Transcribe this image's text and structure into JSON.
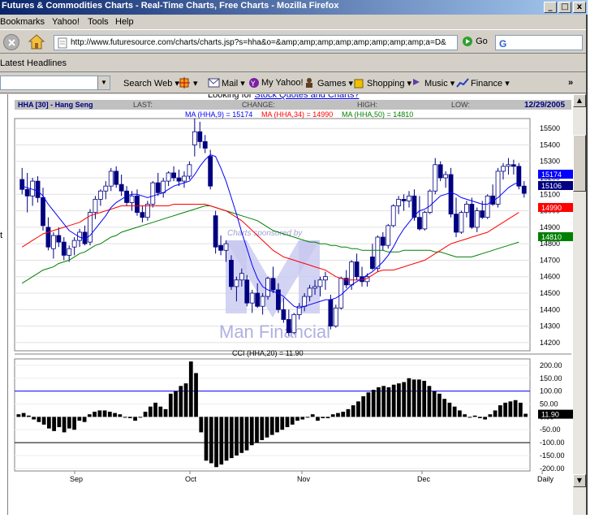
{
  "window": {
    "title": "Futures & Commodities Charts - Real-Time Charts, Free Charts - Mozilla Firefox",
    "minimize": "_",
    "maximize": "□",
    "close": "x"
  },
  "menu": [
    "Bookmarks",
    "Yahoo!",
    "Tools",
    "Help"
  ],
  "navigation": {
    "url": "http://www.futuresource.com/charts/charts.jsp?s=hha&o=&amp;amp;amp;amp;amp;amp;amp;amp;a=D&",
    "go_label": "Go",
    "search_value": ""
  },
  "bookmarks_bar": {
    "item": "Latest Headlines"
  },
  "yahoo_toolbar": {
    "items": [
      "Search Web",
      "Mail",
      "My Yahoo!",
      "Games",
      "Shopping",
      "Music",
      "Finance"
    ],
    "more": "»"
  },
  "page": {
    "lookup_prefix": "Looking for ",
    "lookup_link": "Stock Quotes and Charts?",
    "sidebar_char": "t"
  },
  "colors": {
    "candle_up": "#ffffff",
    "candle_down": "#000080",
    "ma9": "#0000ff",
    "ma34": "#ff0000",
    "ma50": "#008000",
    "cci_bar": "#000000",
    "cci_upper_line": "#0000ff",
    "watermark": "#c8c8f0",
    "header_bg": "#c0c0c0"
  },
  "chart_data": [
    {
      "type": "candlestick",
      "title": "HHA [30] - Hang Seng",
      "header_fields": [
        "LAST:",
        "CHANGE:",
        "HIGH:",
        "LOW:"
      ],
      "date": "12/29/2005",
      "indicators": [
        {
          "name": "MA (HHA,9)",
          "value": "15174",
          "label": "MA (HHA,9) = 15174",
          "color": "#0000ff"
        },
        {
          "name": "MA (HHA,34)",
          "value": "14990",
          "label": "MA (HHA,34) = 14990",
          "color": "#ff0000"
        },
        {
          "name": "MA (HHA,50)",
          "value": "14810",
          "label": "MA (HHA,50) = 14810",
          "color": "#008000"
        }
      ],
      "price_badges": [
        {
          "value": "15174",
          "bg": "#0000ff",
          "fg": "#ffffff"
        },
        {
          "value": "15106",
          "bg": "#000080",
          "fg": "#ffffff"
        },
        {
          "value": "14990",
          "bg": "#ff0000",
          "fg": "#ffffff"
        },
        {
          "value": "14810",
          "bg": "#008000",
          "fg": "#ffffff"
        }
      ],
      "watermark_text": [
        "Charts sponsored by",
        "Man Financial"
      ],
      "x_labels": [
        "Sep",
        "Oct",
        "Nov",
        "Dec",
        "Daily"
      ],
      "y_ticks": [
        15500,
        15400,
        15300,
        15200,
        15100,
        15000,
        14900,
        14800,
        14700,
        14600,
        14500,
        14400,
        14300,
        14200
      ],
      "ylim": [
        14150,
        15560
      ],
      "ohlc": [
        [
          15190,
          15260,
          15100,
          15130
        ],
        [
          15130,
          15230,
          14990,
          15090
        ],
        [
          15090,
          15200,
          15030,
          15180
        ],
        [
          15180,
          15210,
          15050,
          15080
        ],
        [
          15080,
          15140,
          14880,
          14910
        ],
        [
          14900,
          14960,
          14760,
          14780
        ],
        [
          14770,
          14870,
          14710,
          14850
        ],
        [
          14850,
          14900,
          14780,
          14810
        ],
        [
          14810,
          14840,
          14700,
          14730
        ],
        [
          14730,
          14790,
          14690,
          14770
        ],
        [
          14780,
          14840,
          14730,
          14820
        ],
        [
          14820,
          14890,
          14780,
          14870
        ],
        [
          14870,
          14910,
          14790,
          14800
        ],
        [
          14810,
          15010,
          14790,
          14990
        ],
        [
          14990,
          15090,
          14950,
          15070
        ],
        [
          15070,
          15130,
          15030,
          15120
        ],
        [
          15120,
          15180,
          15070,
          15150
        ],
        [
          15150,
          15260,
          15120,
          15240
        ],
        [
          15240,
          15270,
          15140,
          15160
        ],
        [
          15160,
          15220,
          15090,
          15120
        ],
        [
          15120,
          15150,
          15030,
          15050
        ],
        [
          15050,
          15120,
          15000,
          15090
        ],
        [
          15090,
          15130,
          14970,
          14990
        ],
        [
          14990,
          15030,
          14930,
          14960
        ],
        [
          14960,
          15060,
          14940,
          15040
        ],
        [
          15040,
          15180,
          15020,
          15170
        ],
        [
          15170,
          15230,
          15090,
          15110
        ],
        [
          15110,
          15200,
          15080,
          15180
        ],
        [
          15180,
          15240,
          15150,
          15230
        ],
        [
          15230,
          15270,
          15180,
          15200
        ],
        [
          15200,
          15250,
          15150,
          15180
        ],
        [
          15180,
          15240,
          15140,
          15210
        ],
        [
          15210,
          15300,
          15190,
          15280
        ],
        [
          15400,
          15560,
          15330,
          15480
        ],
        [
          15480,
          15540,
          15380,
          15420
        ],
        [
          15420,
          15460,
          15350,
          15380
        ],
        [
          15330,
          15370,
          15130,
          15150
        ],
        [
          14970,
          15000,
          14740,
          14780
        ],
        [
          14790,
          14850,
          14730,
          14760
        ],
        [
          14760,
          14820,
          14690,
          14800
        ],
        [
          14700,
          14730,
          14520,
          14540
        ],
        [
          14540,
          14600,
          14450,
          14580
        ],
        [
          14580,
          14650,
          14540,
          14620
        ],
        [
          14580,
          14610,
          14420,
          14440
        ],
        [
          14440,
          14520,
          14380,
          14500
        ],
        [
          14500,
          14560,
          14410,
          14420
        ],
        [
          14420,
          14500,
          14370,
          14480
        ],
        [
          14480,
          14600,
          14460,
          14590
        ],
        [
          14590,
          14660,
          14500,
          14520
        ],
        [
          14520,
          14560,
          14380,
          14400
        ],
        [
          14400,
          14470,
          14320,
          14340
        ],
        [
          14340,
          14400,
          14240,
          14260
        ],
        [
          14260,
          14380,
          14250,
          14370
        ],
        [
          14370,
          14440,
          14340,
          14420
        ],
        [
          14420,
          14500,
          14390,
          14480
        ],
        [
          14480,
          14550,
          14450,
          14530
        ],
        [
          14530,
          14580,
          14490,
          14540
        ],
        [
          14540,
          14600,
          14480,
          14580
        ],
        [
          14580,
          14630,
          14520,
          14600
        ],
        [
          14460,
          14490,
          14280,
          14300
        ],
        [
          14300,
          14430,
          14290,
          14410
        ],
        [
          14410,
          14600,
          14400,
          14590
        ],
        [
          14590,
          14640,
          14530,
          14550
        ],
        [
          14550,
          14700,
          14520,
          14690
        ],
        [
          14690,
          14740,
          14580,
          14600
        ],
        [
          14600,
          14660,
          14540,
          14570
        ],
        [
          14570,
          14620,
          14540,
          14600
        ],
        [
          14720,
          14800,
          14640,
          14650
        ],
        [
          14650,
          14850,
          14630,
          14840
        ],
        [
          14840,
          14870,
          14760,
          14790
        ],
        [
          14790,
          14920,
          14770,
          14910
        ],
        [
          14910,
          15040,
          14900,
          15030
        ],
        [
          15030,
          15090,
          14980,
          15070
        ],
        [
          15070,
          15100,
          15000,
          15060
        ],
        [
          15060,
          15120,
          15020,
          15090
        ],
        [
          15090,
          15130,
          14940,
          14960
        ],
        [
          14960,
          15090,
          14880,
          14890
        ],
        [
          14890,
          15000,
          14880,
          14990
        ],
        [
          14990,
          15130,
          14980,
          15120
        ],
        [
          15120,
          15320,
          15100,
          15280
        ],
        [
          15280,
          15300,
          15180,
          15200
        ],
        [
          15200,
          15240,
          15140,
          15220
        ],
        [
          15220,
          15260,
          14960,
          14980
        ],
        [
          14980,
          15080,
          14840,
          14870
        ],
        [
          14870,
          15000,
          14860,
          14990
        ],
        [
          14990,
          15060,
          14960,
          15040
        ],
        [
          15040,
          15080,
          14890,
          14900
        ],
        [
          14900,
          15020,
          14870,
          15000
        ],
        [
          15000,
          15060,
          14950,
          14960
        ],
        [
          14960,
          15100,
          14950,
          15090
        ],
        [
          15090,
          15160,
          15030,
          15040
        ],
        [
          15040,
          15260,
          15020,
          15240
        ],
        [
          15240,
          15290,
          15190,
          15270
        ],
        [
          15270,
          15320,
          15220,
          15280
        ],
        [
          15280,
          15310,
          15220,
          15270
        ],
        [
          15270,
          15290,
          15130,
          15150
        ],
        [
          15150,
          15180,
          15080,
          15106
        ]
      ],
      "ma9": [
        15150,
        15140,
        15130,
        15120,
        15090,
        15040,
        15000,
        14960,
        14920,
        14880,
        14860,
        14840,
        14830,
        14850,
        14890,
        14930,
        14970,
        15020,
        15050,
        15070,
        15090,
        15100,
        15100,
        15090,
        15080,
        15090,
        15100,
        15110,
        15130,
        15150,
        15160,
        15170,
        15180,
        15220,
        15270,
        15310,
        15340,
        15330,
        15260,
        15180,
        15080,
        14980,
        14870,
        14770,
        14670,
        14590,
        14540,
        14520,
        14510,
        14500,
        14480,
        14450,
        14420,
        14410,
        14420,
        14430,
        14440,
        14450,
        14460,
        14460,
        14470,
        14490,
        14520,
        14550,
        14570,
        14590,
        14610,
        14630,
        14660,
        14690,
        14730,
        14780,
        14840,
        14890,
        14930,
        14970,
        15000,
        15010,
        15030,
        15060,
        15090,
        15100,
        15110,
        15100,
        15080,
        15070,
        15060,
        15050,
        15040,
        15040,
        15060,
        15080,
        15110,
        15140,
        15160,
        15174
      ],
      "ma34": [
        14780,
        14800,
        14820,
        14840,
        14860,
        14870,
        14880,
        14890,
        14900,
        14910,
        14920,
        14930,
        14950,
        14970,
        14980,
        14990,
        15000,
        15010,
        15020,
        15030,
        15030,
        15030,
        15030,
        15030,
        15030,
        15030,
        15030,
        15030,
        15030,
        15040,
        15040,
        15040,
        15040,
        15040,
        15040,
        15040,
        15030,
        15020,
        15010,
        15000,
        14980,
        14960,
        14940,
        14910,
        14880,
        14850,
        14820,
        14790,
        14760,
        14740,
        14720,
        14710,
        14700,
        14690,
        14680,
        14670,
        14660,
        14650,
        14640,
        14620,
        14600,
        14590,
        14580,
        14580,
        14580,
        14580,
        14590,
        14610,
        14630,
        14640,
        14640,
        14640,
        14650,
        14660,
        14670,
        14680,
        14690,
        14700,
        14720,
        14740,
        14760,
        14780,
        14800,
        14810,
        14820,
        14830,
        14840,
        14850,
        14860,
        14870,
        14890,
        14910,
        14930,
        14950,
        14970,
        14990
      ],
      "ma50": [
        14560,
        14580,
        14600,
        14620,
        14640,
        14650,
        14660,
        14680,
        14690,
        14700,
        14720,
        14740,
        14750,
        14770,
        14790,
        14800,
        14820,
        14840,
        14850,
        14870,
        14880,
        14890,
        14900,
        14910,
        14920,
        14930,
        14940,
        14950,
        14960,
        14970,
        14980,
        14990,
        15000,
        15010,
        15020,
        15030,
        15030,
        15020,
        15010,
        15000,
        14990,
        14980,
        14970,
        14960,
        14950,
        14940,
        14920,
        14900,
        14880,
        14870,
        14860,
        14850,
        14840,
        14830,
        14820,
        14810,
        14810,
        14800,
        14800,
        14790,
        14790,
        14780,
        14780,
        14770,
        14770,
        14760,
        14760,
        14760,
        14760,
        14760,
        14750,
        14750,
        14750,
        14760,
        14760,
        14760,
        14760,
        14760,
        14760,
        14750,
        14750,
        14740,
        14730,
        14720,
        14720,
        14720,
        14720,
        14730,
        14740,
        14750,
        14760,
        14770,
        14780,
        14790,
        14800,
        14810
      ]
    },
    {
      "type": "bar",
      "title": "CCI (HHA,20) = 11.90",
      "value_badge": "11.90",
      "y_ticks": [
        200,
        150,
        100,
        50,
        0,
        -50,
        -100,
        -150,
        -200
      ],
      "ylim": [
        -210,
        225
      ],
      "reference_lines": [
        100,
        -100
      ],
      "values": [
        10,
        15,
        5,
        -10,
        -20,
        -30,
        -45,
        -55,
        -40,
        -60,
        -45,
        -50,
        -15,
        -20,
        10,
        20,
        25,
        25,
        20,
        15,
        10,
        0,
        -5,
        -15,
        0,
        20,
        40,
        55,
        40,
        30,
        90,
        100,
        120,
        130,
        215,
        170,
        -60,
        -170,
        -180,
        -195,
        -185,
        -170,
        -160,
        -150,
        -140,
        -130,
        -110,
        -100,
        -90,
        -80,
        -70,
        -60,
        -50,
        -40,
        -30,
        -15,
        -10,
        0,
        10,
        -15,
        -5,
        -5,
        10,
        15,
        20,
        30,
        45,
        60,
        80,
        95,
        105,
        115,
        120,
        115,
        125,
        130,
        135,
        150,
        145,
        145,
        140,
        120,
        100,
        90,
        70,
        55,
        40,
        25,
        10,
        0,
        5,
        -5,
        -10,
        10,
        25,
        45,
        55,
        60,
        65,
        55,
        12
      ]
    }
  ]
}
